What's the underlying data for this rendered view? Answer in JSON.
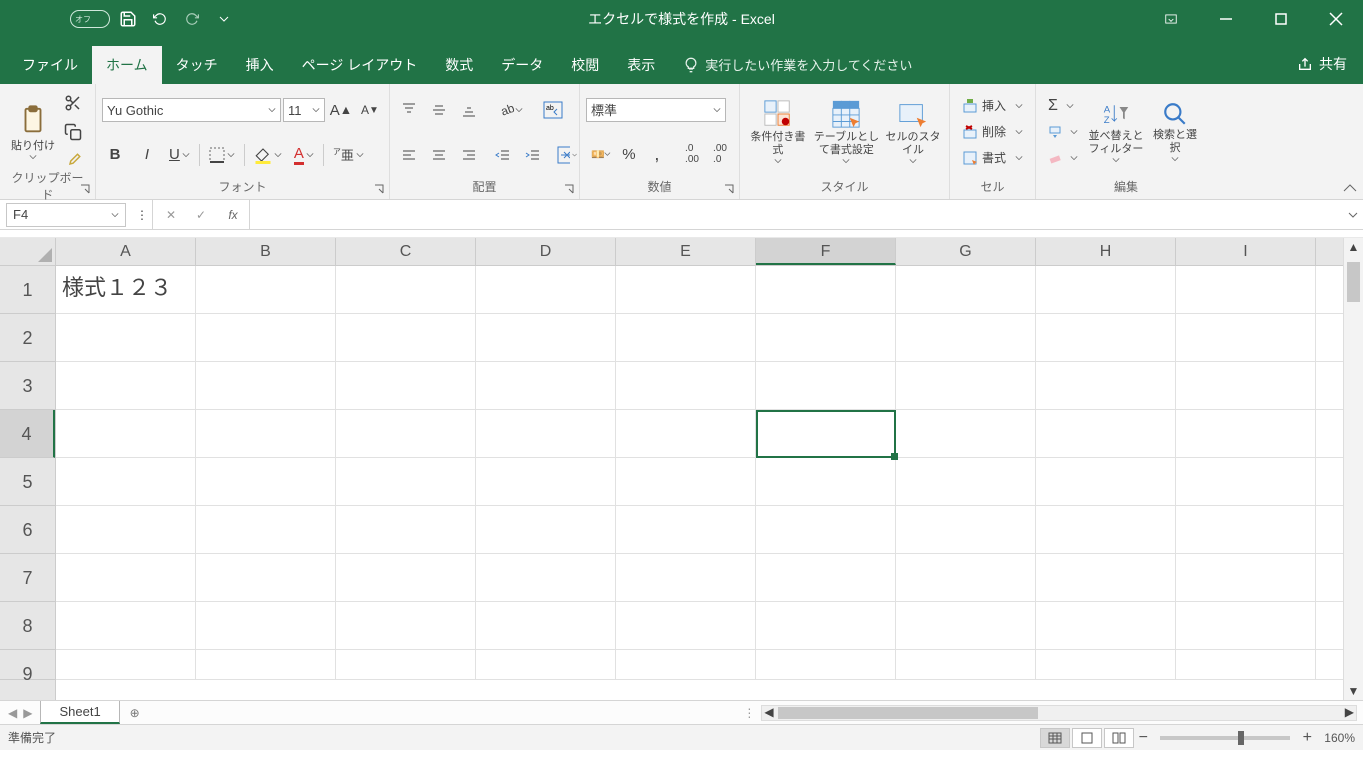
{
  "titlebar": {
    "autosave": "オフ",
    "title": "エクセルで様式を作成 - Excel"
  },
  "tabs": {
    "file": "ファイル",
    "home": "ホーム",
    "touch": "タッチ",
    "insert": "挿入",
    "pagelayout": "ページ レイアウト",
    "formulas": "数式",
    "data": "データ",
    "review": "校閲",
    "view": "表示",
    "tellme_placeholder": "実行したい作業を入力してください",
    "share": "共有"
  },
  "ribbon": {
    "clipboard": {
      "paste": "貼り付け",
      "label": "クリップボード"
    },
    "font": {
      "name": "Yu Gothic",
      "size": "11",
      "bold": "B",
      "italic": "I",
      "underline": "U",
      "label": "フォント"
    },
    "alignment": {
      "label": "配置"
    },
    "number": {
      "format": "標準",
      "label": "数値"
    },
    "styles": {
      "cond": "条件付き書式",
      "table": "テーブルとして書式設定",
      "cell": "セルのスタイル",
      "label": "スタイル"
    },
    "cells": {
      "insert": "挿入",
      "delete": "削除",
      "format": "書式",
      "label": "セル"
    },
    "editing": {
      "sort": "並べ替えとフィルター",
      "find": "検索と選択",
      "label": "編集"
    }
  },
  "formulaBar": {
    "name": "F4",
    "fx": "fx",
    "value": ""
  },
  "grid": {
    "columns": [
      "A",
      "B",
      "C",
      "D",
      "E",
      "F",
      "G",
      "H",
      "I"
    ],
    "rows": [
      "1",
      "2",
      "3",
      "4",
      "5",
      "6",
      "7",
      "8",
      "9"
    ],
    "selectedCell": "F4",
    "data": {
      "A1": "様式１２３"
    }
  },
  "sheets": {
    "active": "Sheet1"
  },
  "status": {
    "ready": "準備完了",
    "zoom": "160%"
  }
}
